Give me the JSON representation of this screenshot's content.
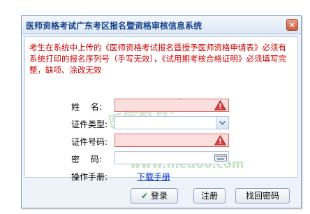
{
  "window": {
    "title": "医师资格考试广东考区报名暨资格审核信息系统",
    "close_glyph": "×"
  },
  "notice": "考生在系统中上传的《医师资格考试报名暨授予医师资格申请表》必须有系统打印的报名序列号（手写无效），《试用期考核合格证明》必须填写完整，缺项、涂改无效",
  "form": {
    "name_label": "姓　 名:",
    "cert_type_label": "证件类型:",
    "cert_no_label": "证件号码:",
    "password_label": "密　 码:",
    "manual_label": "操作手册:",
    "manual_link": "下载手册",
    "name_value": "",
    "cert_type_value": "",
    "cert_no_value": "",
    "password_value": ""
  },
  "watermark": {
    "cn": "医学教育网",
    "url": "www.med66.com"
  },
  "buttons": {
    "login": "登录",
    "login_icon": "✔",
    "register": "注册",
    "recover": "找回密码"
  },
  "colors": {
    "title": "#15428b",
    "notice": "#cc0000",
    "error_bg": "#fbdede",
    "link": "#0033cc"
  }
}
